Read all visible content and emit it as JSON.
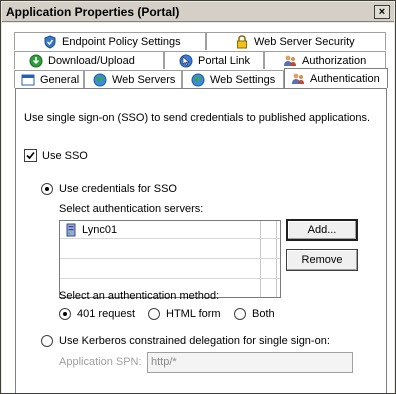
{
  "window": {
    "title": "Application Properties (Portal)",
    "close_glyph": "×"
  },
  "tabs": {
    "row1": [
      {
        "label": "Endpoint Policy Settings",
        "icon": "shield-check-icon"
      },
      {
        "label": "Web Server Security",
        "icon": "padlock-icon"
      }
    ],
    "row2": [
      {
        "label": "Download/Upload",
        "icon": "download-icon"
      },
      {
        "label": "Portal Link",
        "icon": "portal-link-icon"
      },
      {
        "label": "Authorization",
        "icon": "users-icon"
      }
    ],
    "row3": [
      {
        "label": "General",
        "icon": "window-icon"
      },
      {
        "label": "Web Servers",
        "icon": "globe-icon"
      },
      {
        "label": "Web Settings",
        "icon": "globe-icon"
      },
      {
        "label": "Authentication",
        "icon": "users-key-icon",
        "active": true
      }
    ]
  },
  "auth": {
    "description": "Use single sign-on (SSO) to send credentials to published applications.",
    "use_sso_label": "Use SSO",
    "use_sso_checked": true,
    "use_credentials_label": "Use credentials for SSO",
    "select_servers_label": "Select authentication servers:",
    "servers": [
      {
        "name": "Lync01",
        "icon": "server-icon"
      }
    ],
    "add_button": "Add...",
    "remove_button": "Remove",
    "method_label": "Select an authentication method:",
    "methods": [
      {
        "label": "401 request",
        "selected": true
      },
      {
        "label": "HTML form",
        "selected": false
      },
      {
        "label": "Both",
        "selected": false
      }
    ],
    "kerberos_label": "Use Kerberos constrained delegation for single sign-on:",
    "spn_label": "Application SPN:",
    "spn_placeholder": "http/*"
  },
  "colors": {
    "chrome": "#d4d0c8",
    "panel": "#ffffff",
    "border": "#808080",
    "disabled_text": "#a0a0a0"
  }
}
